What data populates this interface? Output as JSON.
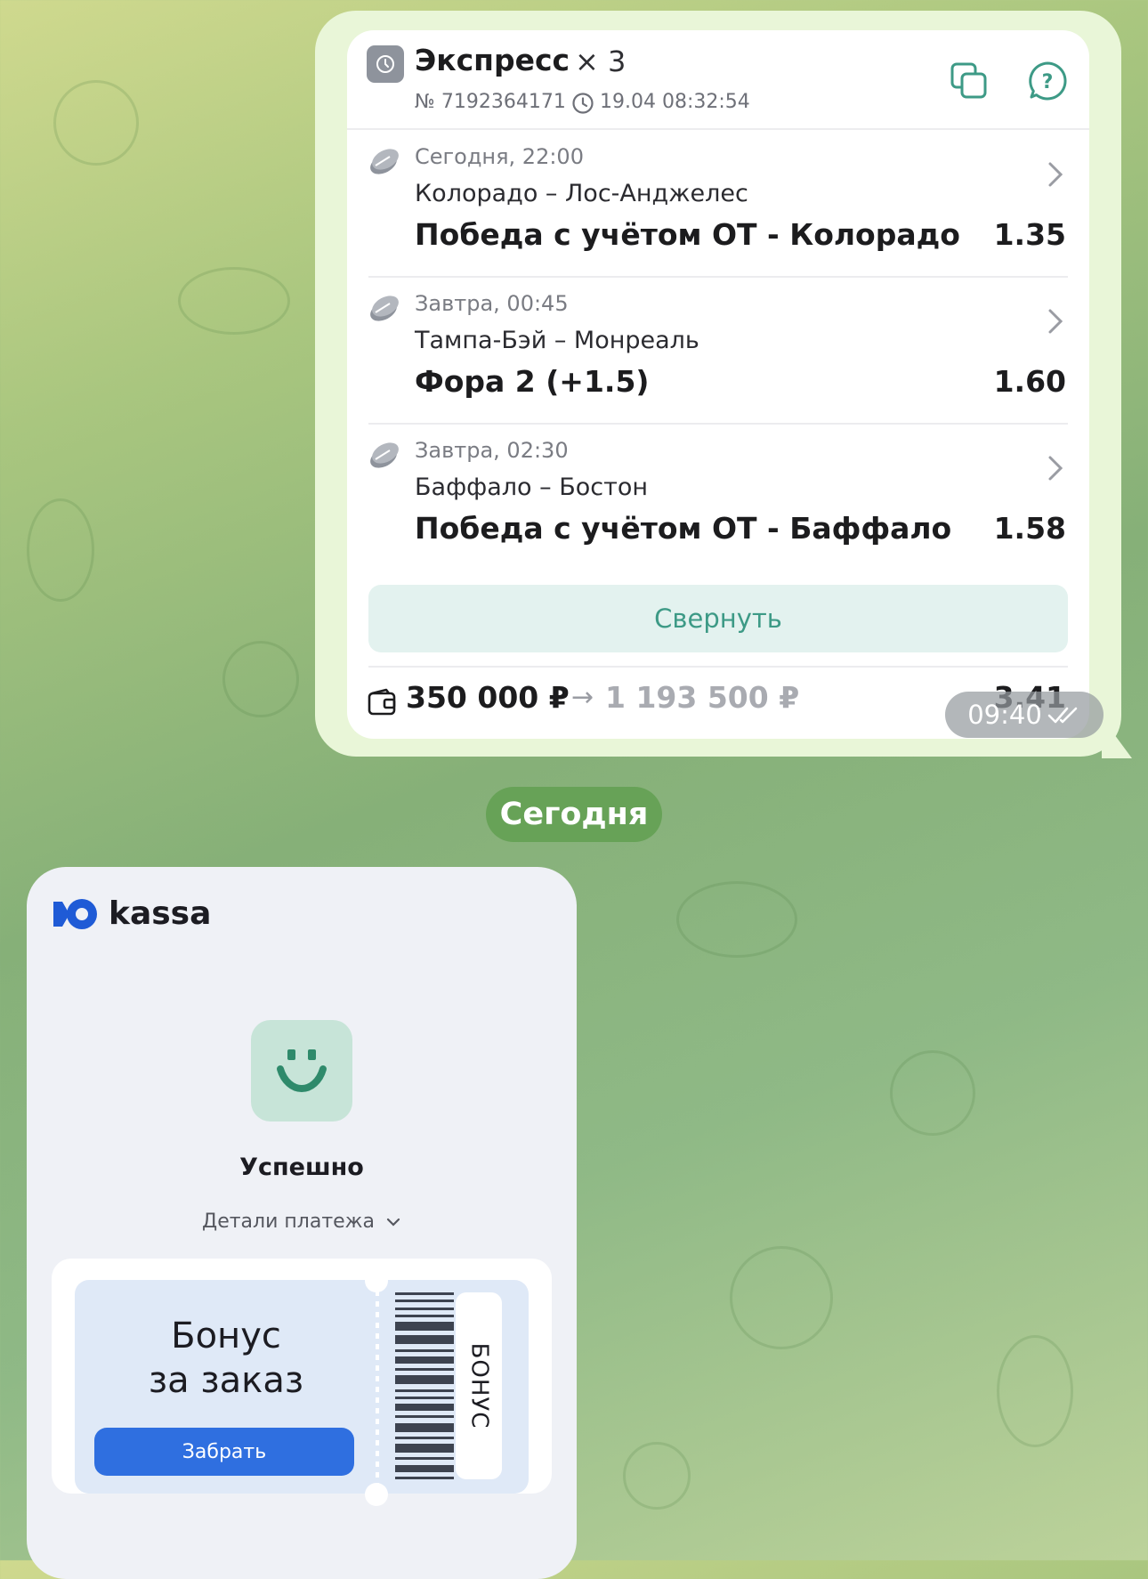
{
  "bet": {
    "title": "Экспресс",
    "multiplier": "× 3",
    "number": "№ 7192364171",
    "timestamp": "19.04 08:32:54",
    "events": [
      {
        "date": "Сегодня, 22:00",
        "teams": "Колорадо – Лос-Анджелес",
        "market": "Победа с учётом ОТ - Колорадо",
        "odds": "1.35"
      },
      {
        "date": "Завтра, 00:45",
        "teams": "Тампа-Бэй – Монреаль",
        "market": "Фора 2 (+1.5)",
        "odds": "1.60"
      },
      {
        "date": "Завтра, 02:30",
        "teams": "Баффало – Бостон",
        "market": "Победа с учётом ОТ - Баффало",
        "odds": "1.58"
      }
    ],
    "collapse_label": "Свернуть",
    "stake": "350 000 ₽",
    "arrow": "→",
    "payout": "1 193 500 ₽",
    "total_odds": "3.41"
  },
  "message_time": "09:40",
  "date_separator": "Сегодня",
  "kassa": {
    "logo_text": "kassa",
    "status": "Успешно",
    "details_label": "Детали платежа",
    "bonus_title_line1": "Бонус",
    "bonus_title_line2": "за заказ",
    "bonus_button": "Забрать",
    "bonus_tag": "БОНУС"
  },
  "icons": [
    "clock-badge-icon",
    "copy-icon",
    "help-icon",
    "hockey-puck-icon",
    "chevron-right-icon",
    "wallet-icon",
    "double-check-icon",
    "chevron-down-icon",
    "smile-icon",
    "barcode-icon"
  ],
  "colors": {
    "accent_teal": "#3d9a86",
    "date_pill": "#67a257",
    "bonus_button": "#2f6fe0"
  }
}
